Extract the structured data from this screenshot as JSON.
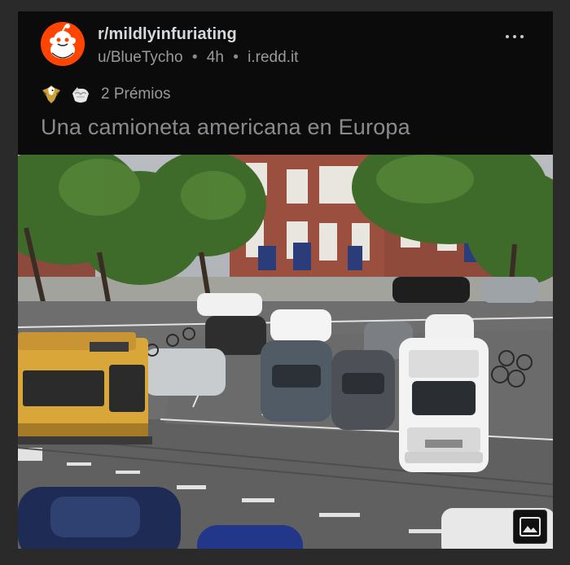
{
  "post": {
    "subreddit": "r/mildlyinfuriating",
    "author": "u/BlueTycho",
    "time": "4h",
    "domain": "i.redd.it",
    "separator": "•",
    "awards_label": "2 Prémios",
    "title": "Una camioneta americana en Europa"
  },
  "icons": {
    "avatar": "subreddit-avatar-icon",
    "more": "more-options-icon",
    "award1": "eagle-award-icon",
    "award2": "wholesome-award-icon",
    "image": "image-gallery-icon"
  },
  "colors": {
    "card_bg": "#0b0b0b",
    "page_bg": "#2a2a2a",
    "avatar_bg": "#ff4500",
    "tram": "#d9a63a"
  }
}
